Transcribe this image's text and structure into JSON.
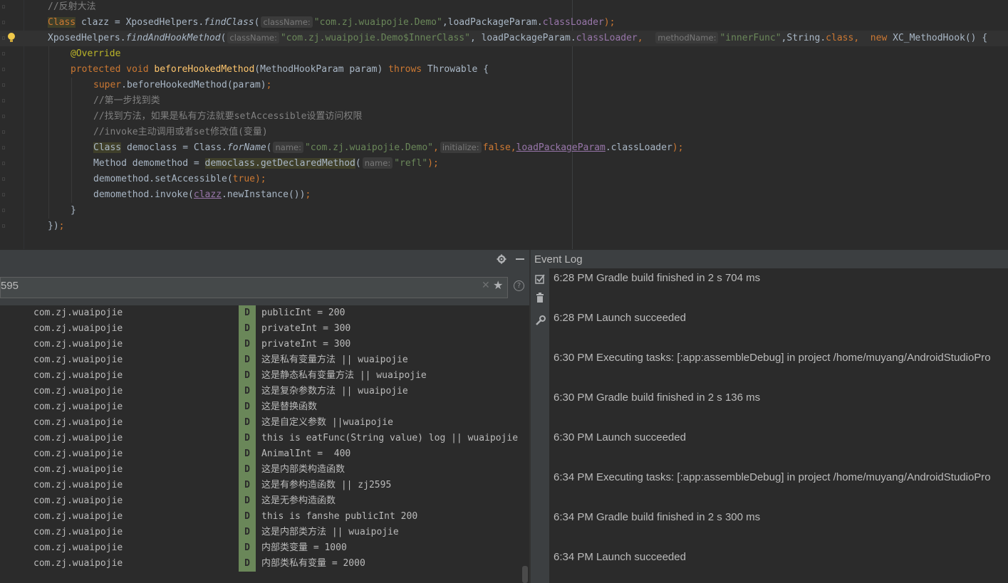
{
  "editor": {
    "lines": [
      {
        "tokens": [
          {
            "t": "//反射大法",
            "c": "cmt"
          }
        ]
      },
      {
        "tokens": [
          {
            "t": "Class",
            "c": "kw hl"
          },
          {
            "t": " clazz = XposedHelpers."
          },
          {
            "t": "findClass",
            "c": "ital"
          },
          {
            "t": "("
          },
          {
            "hint": "className:"
          },
          {
            "t": "\"com.zj.wuaipojie.Demo\"",
            "c": "str"
          },
          {
            "t": ",loadPackageParam."
          },
          {
            "t": "classLoader",
            "c": "fld"
          },
          {
            "t": ");",
            "c": "kw"
          }
        ]
      },
      {
        "tokens": [
          {
            "t": "XposedHelpers."
          },
          {
            "t": "findAndHookMethod",
            "c": "ital"
          },
          {
            "t": "("
          },
          {
            "hint": "className:"
          },
          {
            "t": "\"com.zj.wuaipojie.Demo$InnerClass\"",
            "c": "str"
          },
          {
            "t": ", loadPackageParam."
          },
          {
            "t": "classLoader",
            "c": "fld"
          },
          {
            "t": ",",
            "c": "kw"
          },
          {
            "t": "  "
          },
          {
            "hint": "methodName:"
          },
          {
            "t": "\"innerFunc\"",
            "c": "str"
          },
          {
            "t": ",String."
          },
          {
            "t": "class",
            "c": "kw"
          },
          {
            "t": ",  ",
            "c": "kw"
          },
          {
            "t": "new",
            "c": "kw"
          },
          {
            "t": " XC_MethodHook() {"
          }
        ]
      },
      {
        "tokens": [
          {
            "t": "@Override",
            "c": "ann"
          }
        ]
      },
      {
        "tokens": [
          {
            "t": "protected void ",
            "c": "kw"
          },
          {
            "t": "beforeHookedMethod",
            "c": "meth"
          },
          {
            "t": "(MethodHookParam param) "
          },
          {
            "t": "throws",
            "c": "kw"
          },
          {
            "t": " Throwable {"
          }
        ]
      },
      {
        "tokens": [
          {
            "t": "super",
            "c": "kw"
          },
          {
            "t": ".beforeHookedMethod(param)"
          },
          {
            "t": ";",
            "c": "kw"
          }
        ]
      },
      {
        "tokens": [
          {
            "t": "//第一步找到类",
            "c": "cmt"
          }
        ]
      },
      {
        "tokens": [
          {
            "t": "//找到方法，如果是私有方法就要setAccessible设置访问权限",
            "c": "cmt"
          }
        ]
      },
      {
        "tokens": [
          {
            "t": "//invoke主动调用或者set修改值(变量)",
            "c": "cmt"
          }
        ]
      },
      {
        "tokens": [
          {
            "t": "Class",
            "c": "hl"
          },
          {
            "t": " democlass = Class."
          },
          {
            "t": "forName",
            "c": "ital"
          },
          {
            "t": "("
          },
          {
            "hint": "name:"
          },
          {
            "t": "\"com.zj.wuaipojie.Demo\"",
            "c": "str"
          },
          {
            "t": ",",
            "c": "kw"
          },
          {
            "hint": "initialize:"
          },
          {
            "t": "false",
            "c": "kw"
          },
          {
            "t": ",",
            "c": "kw"
          },
          {
            "t": "loadPackageParam",
            "c": "fld uline"
          },
          {
            "t": "."
          },
          {
            "t": "classLoader",
            "c": ""
          },
          {
            "t": ");",
            "c": "kw"
          }
        ]
      },
      {
        "tokens": [
          {
            "t": "Method demomethod = "
          },
          {
            "t": "democlass.getDeclaredMethod",
            "c": "hl"
          },
          {
            "t": "("
          },
          {
            "hint": "name:"
          },
          {
            "t": "\"refl\"",
            "c": "str"
          },
          {
            "t": ");",
            "c": "kw"
          }
        ]
      },
      {
        "tokens": [
          {
            "t": "demomethod.setAccessible("
          },
          {
            "t": "true",
            "c": "kw"
          },
          {
            "t": ");",
            "c": "kw"
          }
        ]
      },
      {
        "tokens": [
          {
            "t": "demomethod.invoke("
          },
          {
            "t": "clazz",
            "c": "fld uline"
          },
          {
            "t": ".newInstance())"
          },
          {
            "t": ";",
            "c": "kw"
          }
        ]
      },
      {
        "tokens": [
          {
            "t": "}"
          }
        ]
      },
      {
        "tokens": [
          {
            "t": "})"
          },
          {
            "t": ";",
            "c": "kw"
          }
        ]
      }
    ]
  },
  "logcat": {
    "filter_value": "595",
    "rows": [
      {
        "pkg": "com.zj.wuaipojie",
        "level": "D",
        "msg": "publicInt = 200"
      },
      {
        "pkg": "com.zj.wuaipojie",
        "level": "D",
        "msg": "privateInt = 300"
      },
      {
        "pkg": "com.zj.wuaipojie",
        "level": "D",
        "msg": "privateInt = 300"
      },
      {
        "pkg": "com.zj.wuaipojie",
        "level": "D",
        "msg": "这是私有变量方法 || wuaipojie"
      },
      {
        "pkg": "com.zj.wuaipojie",
        "level": "D",
        "msg": "这是静态私有变量方法 || wuaipojie"
      },
      {
        "pkg": "com.zj.wuaipojie",
        "level": "D",
        "msg": "这是复杂参数方法 || wuaipojie"
      },
      {
        "pkg": "com.zj.wuaipojie",
        "level": "D",
        "msg": "这是替换函数"
      },
      {
        "pkg": "com.zj.wuaipojie",
        "level": "D",
        "msg": "这是自定义参数 ||wuaipojie"
      },
      {
        "pkg": "com.zj.wuaipojie",
        "level": "D",
        "msg": "this is eatFunc(String value) log || wuaipojie"
      },
      {
        "pkg": "com.zj.wuaipojie",
        "level": "D",
        "msg": "AnimalInt =  400"
      },
      {
        "pkg": "com.zj.wuaipojie",
        "level": "D",
        "msg": "这是内部类构造函数"
      },
      {
        "pkg": "com.zj.wuaipojie",
        "level": "D",
        "msg": "这是有参构造函数 || zj2595"
      },
      {
        "pkg": "com.zj.wuaipojie",
        "level": "D",
        "msg": "这是无参构造函数"
      },
      {
        "pkg": "com.zj.wuaipojie",
        "level": "D",
        "msg": "this is fanshe publicInt 200"
      },
      {
        "pkg": "com.zj.wuaipojie",
        "level": "D",
        "msg": "这是内部类方法 || wuaipojie"
      },
      {
        "pkg": "com.zj.wuaipojie",
        "level": "D",
        "msg": "内部类变量 = 1000"
      },
      {
        "pkg": "com.zj.wuaipojie",
        "level": "D",
        "msg": "内部类私有变量 = 2000"
      }
    ]
  },
  "event_log": {
    "title": "Event Log",
    "entries": [
      {
        "time": "6:28 PM",
        "msg": "Gradle build finished in 2 s 704 ms"
      },
      {
        "time": "6:28 PM",
        "msg": "Launch succeeded"
      },
      {
        "time": "6:30 PM",
        "msg": "Executing tasks: [:app:assembleDebug] in project /home/muyang/AndroidStudioPro"
      },
      {
        "time": "6:30 PM",
        "msg": "Gradle build finished in 2 s 136 ms"
      },
      {
        "time": "6:30 PM",
        "msg": "Launch succeeded"
      },
      {
        "time": "6:34 PM",
        "msg": "Executing tasks: [:app:assembleDebug] in project /home/muyang/AndroidStudioPro"
      },
      {
        "time": "6:34 PM",
        "msg": "Gradle build finished in 2 s 300 ms"
      },
      {
        "time": "6:34 PM",
        "msg": "Launch succeeded"
      }
    ]
  },
  "icons": {
    "settings": "gear-icon",
    "minimize": "minimize-icon",
    "clear_filter": "close-icon",
    "favorite": "star-icon",
    "help": "help-icon",
    "mark_read": "checkbox-icon",
    "delete": "trash-icon",
    "settings_wrench": "wrench-icon",
    "intention": "lightbulb-icon"
  },
  "colors": {
    "keyword": "#cc7832",
    "string": "#6a8759",
    "comment": "#808080",
    "annotation": "#bbb529",
    "method": "#ffc66d",
    "field": "#9876aa",
    "debug_badge": "#6a8759"
  }
}
